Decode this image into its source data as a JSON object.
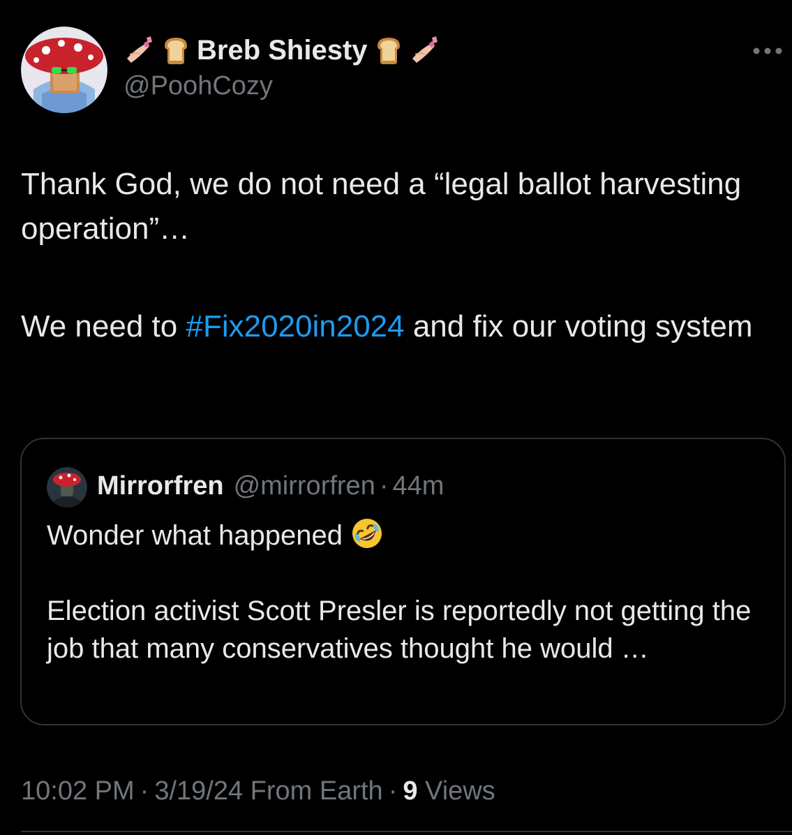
{
  "author": {
    "display_name": "Breb Shiesty",
    "handle": "@PoohCozy",
    "name_emojis": [
      "nail-polish-icon",
      "bread-icon"
    ]
  },
  "tweet": {
    "line1": "Thank God, we do not need a “legal ballot harvesting operation”…",
    "line2_before": "We need to ",
    "hashtag": "#Fix2020in2024",
    "line2_after": " and fix our voting system"
  },
  "quote": {
    "display_name": "Mirrorfren",
    "handle": "@mirrorfren",
    "separator": "·",
    "time": "44m",
    "line1": "Wonder what happened",
    "line1_emoji": "rolling-on-floor-laughing-icon",
    "line2": "Election activist Scott Presler is reportedly not getting the job that many conservatives thought he would …"
  },
  "meta": {
    "time": "10:02 PM",
    "separator": "·",
    "date_source": "3/19/24 From Earth",
    "views_count": "9",
    "views_label": " Views"
  },
  "colors": {
    "background": "#000000",
    "text": "#e7e9ea",
    "secondary": "#71767b",
    "link": "#1d9bf0",
    "border": "#2f3336"
  }
}
